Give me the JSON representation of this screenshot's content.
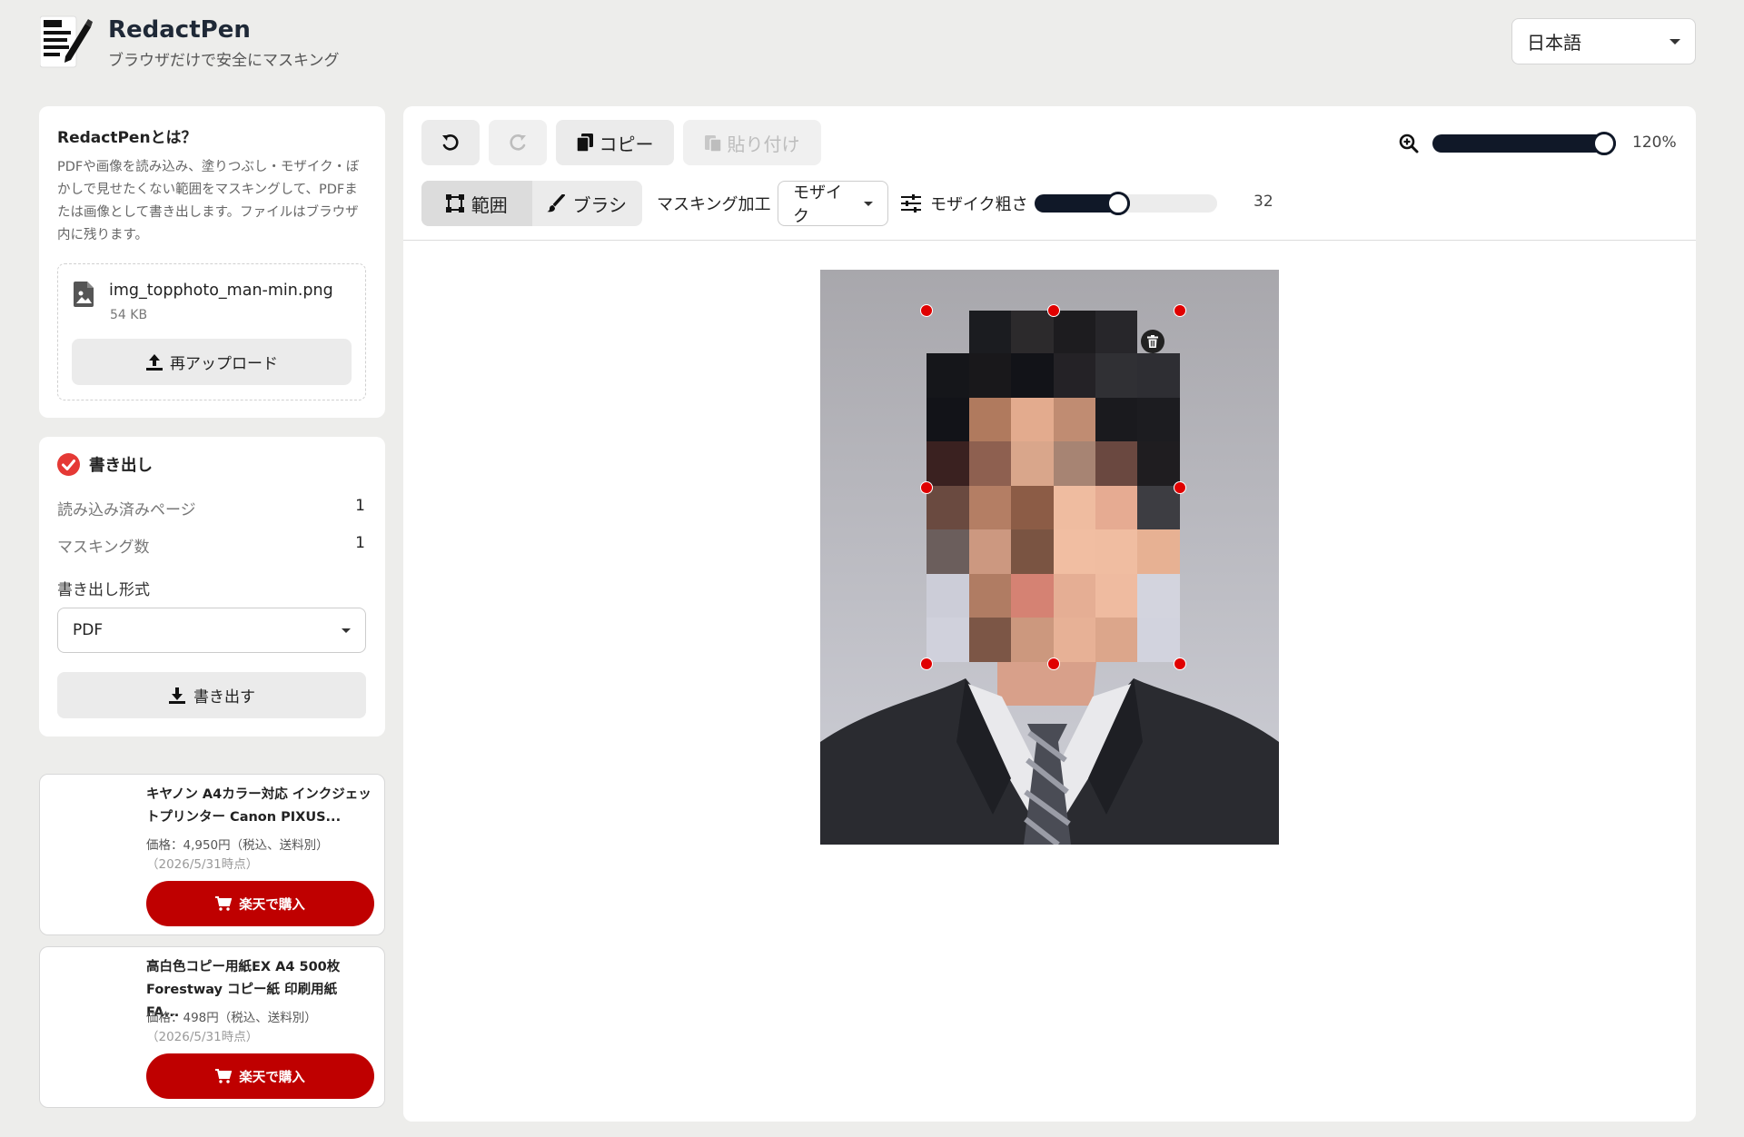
{
  "header": {
    "app_title": "RedactPen",
    "app_subtitle": "ブラウザだけで安全にマスキング",
    "language": "日本語"
  },
  "about": {
    "title": "RedactPenとは？",
    "description": "PDFや画像を読み込み、塗りつぶし・モザイク・ぼかしで見せたくない範囲をマスキングして、PDFまたは画像として書き出します。ファイルはブラウザ内に残ります。",
    "file_name": "img_topphoto_man-min.png",
    "file_size": "54 KB",
    "reupload_label": "再アップロード"
  },
  "export": {
    "title": "書き出し",
    "pages_label": "読み込み済みページ",
    "pages_value": "1",
    "masks_label": "マスキング数",
    "masks_value": "1",
    "format_label": "書き出し形式",
    "format_value": "PDF",
    "export_button": "書き出す"
  },
  "ads": [
    {
      "title": "キヤノン A4カラー対応 インクジェットプリンター Canon PIXUS...",
      "price": "価格：4,950円（税込、送料別）",
      "date": "（2026/5/31時点）",
      "button": "楽天で購入"
    },
    {
      "title": "高白色コピー用紙EX A4 500枚 Forestway コピー紙 印刷用紙 FA...",
      "price": "価格：498円（税込、送料別）",
      "date": "（2026/5/31時点）",
      "button": "楽天で購入"
    }
  ],
  "toolbar": {
    "copy_label": "コピー",
    "paste_label": "貼り付け",
    "zoom_value": "120%",
    "zoom_level": 1.0,
    "range_label": "範囲",
    "brush_label": "ブラシ",
    "masking_label": "マスキング加工",
    "masking_mode": "モザイク",
    "coarseness_label": "モザイク粗さ",
    "coarseness_value": "32",
    "coarseness_level": 0.45
  },
  "colors": {
    "accent_dark": "#101828",
    "handle_red": "#e00000",
    "rakuten_red": "#bf0000",
    "check_red": "#e53935"
  }
}
